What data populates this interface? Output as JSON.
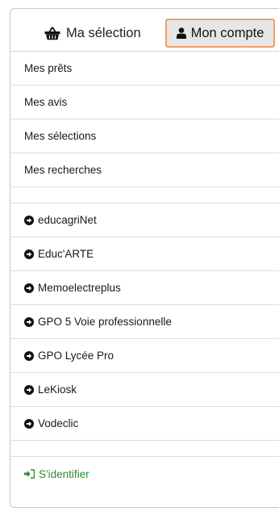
{
  "header": {
    "selection_label": "Ma sélection",
    "account_label": "Mon compte",
    "selection_icon": "basket-icon",
    "account_icon": "user-icon"
  },
  "account_menu": {
    "items": [
      {
        "label": "Mes prêts"
      },
      {
        "label": "Mes avis"
      },
      {
        "label": "Mes sélections"
      },
      {
        "label": "Mes recherches"
      }
    ]
  },
  "resources": {
    "icon": "circle-arrow-right-icon",
    "items": [
      {
        "label": "educagriNet"
      },
      {
        "label": "Educ'ARTE"
      },
      {
        "label": "Memoelectreplus"
      },
      {
        "label": "GPO 5 Voie professionnelle"
      },
      {
        "label": "GPO Lycée Pro"
      },
      {
        "label": "LeKiosk"
      },
      {
        "label": "Vodeclic"
      }
    ]
  },
  "login": {
    "label": "S'identifier",
    "icon": "sign-in-icon",
    "color": "#2e8b2e"
  },
  "colors": {
    "active_border": "#f0a06d",
    "active_bg": "#e6e6e6"
  }
}
